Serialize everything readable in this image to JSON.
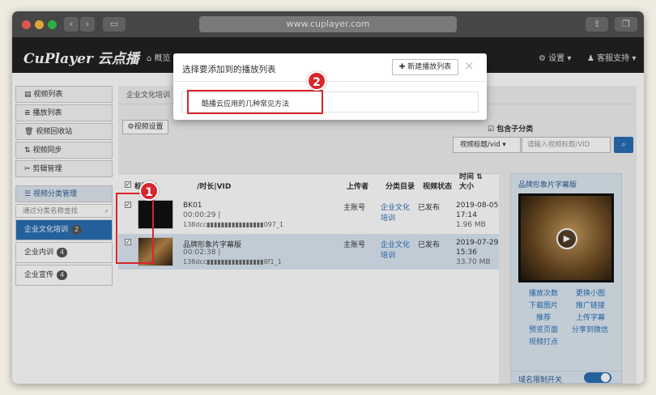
{
  "browser": {
    "url": "www.cuplayer.com",
    "back": "‹",
    "forward": "›"
  },
  "app": {
    "logo": "CuPlayer 云点播",
    "nav_overview": "概览",
    "settings": "设置",
    "support": "客服支持"
  },
  "sidebar": {
    "items": [
      {
        "label": "视频列表"
      },
      {
        "label": "播放列表"
      },
      {
        "label": "视频回收站"
      },
      {
        "label": "视频同步"
      },
      {
        "label": "剪辑管理"
      }
    ],
    "category_header": "视频分类管理",
    "search_placeholder": "通过分类名称查找",
    "categories": [
      {
        "label": "企业文化培训",
        "count": "2"
      },
      {
        "label": "企业内训",
        "count": "4"
      },
      {
        "label": "企业宣传",
        "count": "4"
      }
    ]
  },
  "main": {
    "breadcrumb": "企业文化培训",
    "settings_btn": "视频设置",
    "include_sub": "包含子分类",
    "filter_select": "视频标题/vid",
    "search_placeholder": "请输入视频标题/VID",
    "headers": {
      "title": "标题",
      "duration_vid": "/时长|VID",
      "uploader": "上传者",
      "category": "分类目录",
      "status": "视频状态",
      "time": "时间",
      "size": "大小"
    },
    "rows": [
      {
        "title": "BK01",
        "duration": "00:00:29 |",
        "vid": "138dcc▮▮▮▮▮▮▮▮▮▮▮▮▮▮▮▮097_1",
        "uploader": "主账号",
        "category": "企业文化培训",
        "status": "已发布",
        "date": "2019-08-05",
        "time": "17:14",
        "size": "1.96 MB"
      },
      {
        "title": "品牌形象片字幕版",
        "duration": "00:02:38 |",
        "vid": "138dcc▮▮▮▮▮▮▮▮▮▮▮▮▮▮▮▮8f1_1",
        "uploader": "主账号",
        "category": "企业文化培训",
        "status": "已发布",
        "date": "2019-07-29",
        "time": "15:36",
        "size": "33.70 MB"
      }
    ]
  },
  "preview": {
    "title": "品牌形象片字幕版",
    "links": [
      "播放次数",
      "更换小图",
      "下载图片",
      "推广链接",
      "推荐",
      "上传字幕",
      "预览页面",
      "分享到微信",
      "视频打点"
    ],
    "domain_toggle": "域名限制开关"
  },
  "modal": {
    "title": "选择要添加到的播放列表",
    "new_btn": "新建播放列表",
    "close": "×",
    "item": "酷播云应用的几种常见方法"
  },
  "callouts": [
    "1",
    "2"
  ],
  "colors": {
    "accent": "#2a6fb2",
    "callout": "#d9262c"
  }
}
